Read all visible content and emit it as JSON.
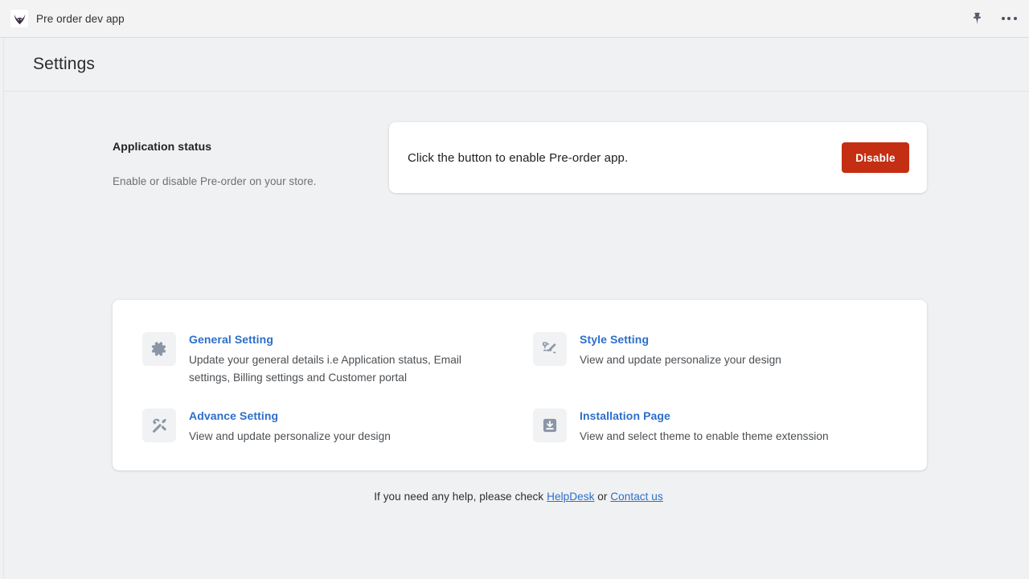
{
  "topbar": {
    "app_title": "Pre order dev app",
    "favicon_icon": "bat-app-logo-icon",
    "pin_icon": "pin-icon",
    "more_icon": "more-horizontal-icon"
  },
  "header": {
    "title": "Settings"
  },
  "application_status": {
    "heading": "Application status",
    "subtext": "Enable or disable Pre-order on your store.",
    "card_message": "Click the button to enable Pre-order app.",
    "button_label": "Disable",
    "button_color": "#c42e12"
  },
  "settings_links": [
    {
      "title": "General Setting",
      "description": "Update your general details i.e Application status, Email settings, Billing settings and Customer portal",
      "icon": "gear-icon"
    },
    {
      "title": "Style Setting",
      "description": "View and update personalize your design",
      "icon": "style-pen-icon"
    },
    {
      "title": "Advance Setting",
      "description": "View and update personalize your design",
      "icon": "tools-icon"
    },
    {
      "title": "Installation Page",
      "description": "View and select theme to enable theme extenssion",
      "icon": "install-download-icon"
    }
  ],
  "footer": {
    "text_before": "If you need any help, please check ",
    "link_helpdesk": "HelpDesk",
    "text_between": " or ",
    "link_contact": "Contact us"
  },
  "colors": {
    "link_blue": "#2c6ecb",
    "danger_red": "#c42e12",
    "page_bg": "#f0f1f2",
    "icon_slate": "#8a96a6"
  }
}
